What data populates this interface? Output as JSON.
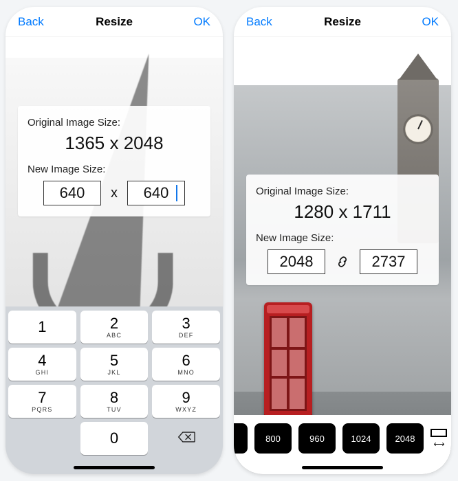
{
  "phoneA": {
    "nav": {
      "back": "Back",
      "title": "Resize",
      "ok": "OK"
    },
    "panel": {
      "original_label": "Original Image Size:",
      "original_value": "1365 x 2048",
      "new_label": "New Image Size:",
      "width": "640",
      "separator": "x",
      "height": "640"
    },
    "keypad": {
      "keys": [
        {
          "d": "1",
          "s": ""
        },
        {
          "d": "2",
          "s": "ABC"
        },
        {
          "d": "3",
          "s": "DEF"
        },
        {
          "d": "4",
          "s": "GHI"
        },
        {
          "d": "5",
          "s": "JKL"
        },
        {
          "d": "6",
          "s": "MNO"
        },
        {
          "d": "7",
          "s": "PQRS"
        },
        {
          "d": "8",
          "s": "TUV"
        },
        {
          "d": "9",
          "s": "WXYZ"
        }
      ],
      "zero": "0"
    }
  },
  "phoneB": {
    "nav": {
      "back": "Back",
      "title": "Resize",
      "ok": "OK"
    },
    "panel": {
      "original_label": "Original Image Size:",
      "original_value": "1280 x 1711",
      "new_label": "New Image Size:",
      "width": "2048",
      "height": "2737"
    },
    "presets": [
      "800",
      "960",
      "1024",
      "2048"
    ]
  }
}
